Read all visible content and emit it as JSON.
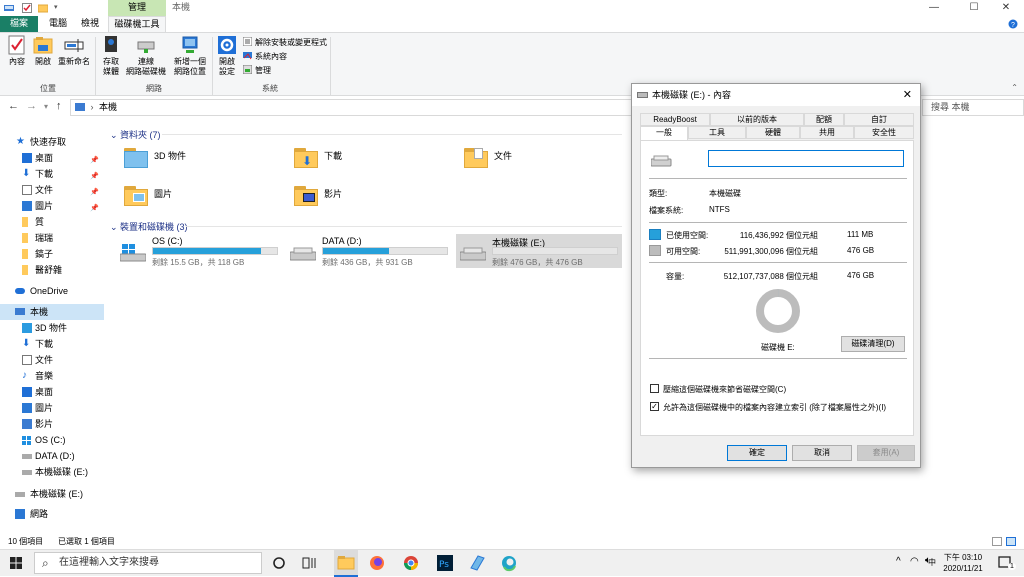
{
  "window": {
    "context_tab": "管理",
    "title": "本機",
    "controls": {
      "minimize": "—",
      "maximize": "☐",
      "close": "✕"
    }
  },
  "ribbon_tabs": {
    "file": "檔案",
    "computer": "電腦",
    "view": "檢視",
    "drive_tools": "磁碟機工具"
  },
  "ribbon": {
    "properties": "內容",
    "open": "開啟",
    "rename": "重新命名",
    "access_media": [
      "存取",
      "媒體"
    ],
    "map_drive": [
      "連線",
      "網路磁碟機"
    ],
    "add_location": [
      "新增一個",
      "網路位置"
    ],
    "open_settings": [
      "開啟",
      "設定"
    ],
    "uninstall": "解除安裝或變更程式",
    "system_properties": "系統內容",
    "manage": "管理",
    "group_location": "位置",
    "group_network": "網路",
    "group_system": "系統"
  },
  "address": {
    "path": "本機",
    "search_placeholder": "搜尋 本機"
  },
  "nav": {
    "quick_access": "快速存取",
    "qa_items": [
      "桌面",
      "下載",
      "文件",
      "圖片",
      "質",
      "瑞瑞",
      "鎬子",
      "醫舒雜"
    ],
    "onedrive": "OneDrive",
    "this_pc": "本機",
    "pc_items": [
      "3D 物件",
      "下載",
      "文件",
      "音樂",
      "桌面",
      "圖片",
      "影片",
      "OS (C:)",
      "DATA (D:)",
      "本機磁碟 (E:)"
    ],
    "local_disk": "本機磁碟 (E:)",
    "network": "網路"
  },
  "content": {
    "folders_header": "資料夾 (7)",
    "folders": [
      "3D 物件",
      "下載",
      "文件",
      "圖片",
      "影片"
    ],
    "drives_header": "裝置和磁碟機 (3)",
    "drives": [
      {
        "name": "OS (C:)",
        "free": "剩餘 15.5 GB，共 118 GB",
        "used_fraction": 0.87
      },
      {
        "name": "DATA (D:)",
        "free": "剩餘 436 GB，共 931 GB",
        "used_fraction": 0.53
      },
      {
        "name": "本機磁碟 (E:)",
        "free": "剩餘 476 GB，共 476 GB",
        "used_fraction": 0.0
      }
    ]
  },
  "status": {
    "count": "10 個項目",
    "selected": "已選取 1 個項目"
  },
  "taskbar": {
    "search_placeholder": "在這裡輸入文字來搜尋",
    "time": "下午 03:10",
    "date": "2020/11/21",
    "ime": "中",
    "notification_count": "1"
  },
  "dialog": {
    "title": "本機磁碟 (E:) - 內容",
    "tabs_row1": [
      "ReadyBoost",
      "以前的版本",
      "配額",
      "自訂"
    ],
    "tabs_row2": [
      "一般",
      "工具",
      "硬體",
      "共用",
      "安全性"
    ],
    "name_value": "",
    "type_label": "類型:",
    "type_value": "本機磁碟",
    "fs_label": "檔案系統:",
    "fs_value": "NTFS",
    "used_label": "已使用空間:",
    "used_bytes": "116,436,992 個位元組",
    "used_size": "111 MB",
    "free_label": "可用空間:",
    "free_bytes": "511,991,300,096 個位元組",
    "free_size": "476 GB",
    "capacity_label": "容量:",
    "capacity_bytes": "512,107,737,088 個位元組",
    "capacity_size": "476 GB",
    "drive_label": "磁碟機 E:",
    "cleanup_button": "磁碟清理(D)",
    "compress_label": "壓縮這個磁碟機來節省磁碟空間(C)",
    "compress_checked": false,
    "index_label": "允許為這個磁碟機中的檔案內容建立索引 (除了檔案屬性之外)(I)",
    "index_checked": true,
    "ok": "確定",
    "cancel": "取消",
    "apply": "套用(A)",
    "used_fraction": 0.0002,
    "colors": {
      "used": "#26a0da",
      "free": "#bcbcbc"
    }
  }
}
